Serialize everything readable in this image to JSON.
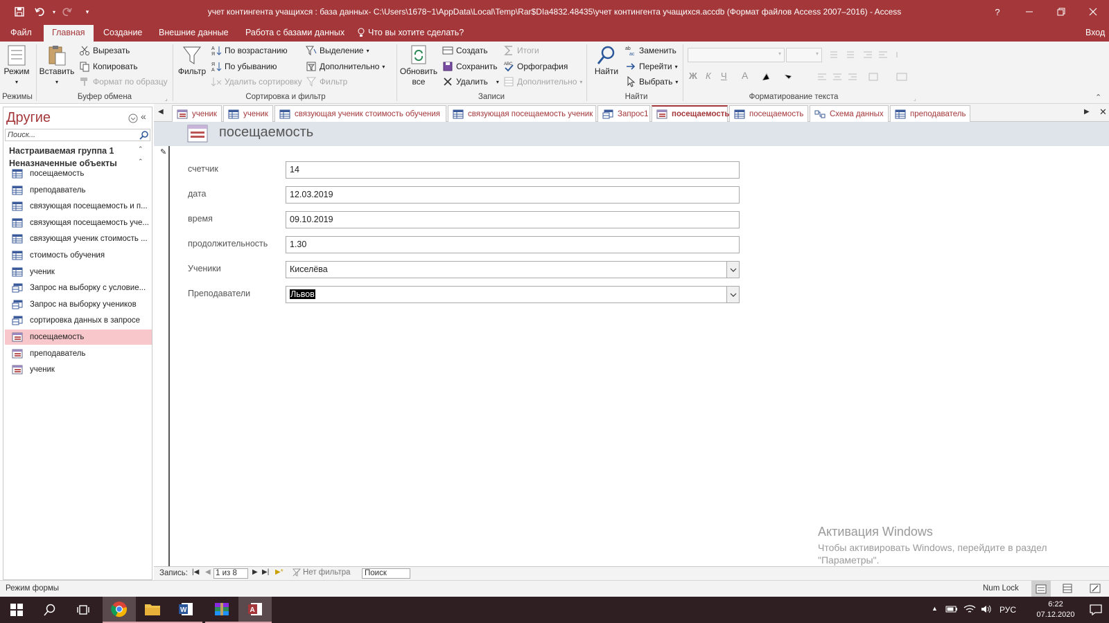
{
  "window": {
    "title": "учет контингента учащихся : база данных- C:\\Users\\1678~1\\AppData\\Local\\Temp\\Rar$DIa4832.48435\\учет контингента учащихся.accdb (Формат файлов Access 2007–2016) - Access",
    "help": "?"
  },
  "menu": {
    "file": "Файл",
    "home": "Главная",
    "create": "Создание",
    "external": "Внешние данные",
    "dbtools": "Работа с базами данных",
    "tell": "Что вы хотите сделать?",
    "signin": "Вход"
  },
  "ribbon": {
    "mode": {
      "label": "Режим",
      "group": "Режимы"
    },
    "clipboard": {
      "paste": "Вставить",
      "cut": "Вырезать",
      "copy": "Копировать",
      "format_painter": "Формат по образцу",
      "group": "Буфер обмена"
    },
    "sort": {
      "filter": "Фильтр",
      "asc": "По возрастанию",
      "desc": "По убыванию",
      "remove_sort": "Удалить сортировку",
      "selection": "Выделение",
      "advanced": "Дополнительно",
      "toggle_filter": "Фильтр",
      "group": "Сортировка и фильтр"
    },
    "records": {
      "refresh_line1": "Обновить",
      "refresh_line2": "все",
      "new": "Создать",
      "save": "Сохранить",
      "delete": "Удалить",
      "totals": "Итоги",
      "spelling": "Орфография",
      "more": "Дополнительно",
      "group": "Записи"
    },
    "find": {
      "find": "Найти",
      "replace": "Заменить",
      "goto": "Перейти",
      "select": "Выбрать",
      "group": "Найти"
    },
    "text": {
      "bold": "Ж",
      "italic": "К",
      "underline": "Ч",
      "font_color": "A",
      "group": "Форматирование текста"
    }
  },
  "nav": {
    "header": "Другие",
    "search_placeholder": "Поиск...",
    "group1": "Настраиваемая группа 1",
    "group2": "Неназначенные объекты",
    "items": [
      {
        "label": "посещаемость",
        "type": "table"
      },
      {
        "label": "преподаватель",
        "type": "table"
      },
      {
        "label": "связующая посещаемость и п...",
        "type": "table"
      },
      {
        "label": "связующая посещаемость уче...",
        "type": "table"
      },
      {
        "label": "связующая ученик стоимость ...",
        "type": "table"
      },
      {
        "label": "стоимость обучения",
        "type": "table"
      },
      {
        "label": "ученик",
        "type": "table"
      },
      {
        "label": "Запрос на выборку с условие...",
        "type": "query"
      },
      {
        "label": "Запрос на выборку учеников",
        "type": "query"
      },
      {
        "label": "сортировка данных в запросе",
        "type": "query"
      },
      {
        "label": "посещаемость",
        "type": "form",
        "selected": true
      },
      {
        "label": "преподаватель",
        "type": "form"
      },
      {
        "label": "ученик",
        "type": "form"
      }
    ]
  },
  "doctabs": [
    {
      "label": "ученик",
      "type": "form"
    },
    {
      "label": "ученик",
      "type": "table"
    },
    {
      "label": "связующая ученик стоимость обучения",
      "type": "table"
    },
    {
      "label": "связующая посещаемость ученик",
      "type": "table"
    },
    {
      "label": "Запрос1",
      "type": "query"
    },
    {
      "label": "посещаемость",
      "type": "form",
      "active": true
    },
    {
      "label": "посещаемость",
      "type": "table"
    },
    {
      "label": "Схема данных",
      "type": "relations"
    },
    {
      "label": "преподаватель",
      "type": "table"
    }
  ],
  "form": {
    "title": "посещаемость",
    "fields": {
      "counter": {
        "label": "счетчик",
        "value": "14"
      },
      "date": {
        "label": "дата",
        "value": "12.03.2019"
      },
      "time": {
        "label": "время",
        "value": "09.10.2019"
      },
      "duration": {
        "label": "продолжительность",
        "value": "1.30"
      },
      "students": {
        "label": "Ученики",
        "value": "Киселёва"
      },
      "teachers": {
        "label": "Преподаватели",
        "value": "Львов"
      }
    }
  },
  "recordnav": {
    "label": "Запись:",
    "position": "1 из 8",
    "filter": "Нет фильтра",
    "search": "Поиск"
  },
  "status": {
    "mode": "Режим формы",
    "numlock": "Num Lock"
  },
  "watermark": {
    "title": "Активация Windows",
    "line1": "Чтобы активировать Windows, перейдите в раздел",
    "line2": "\"Параметры\"."
  },
  "taskbar": {
    "lang": "РУС",
    "time": "6:22",
    "date": "07.12.2020"
  },
  "colors": {
    "accent": "#a4373a",
    "selection": "#f7c7cb"
  }
}
